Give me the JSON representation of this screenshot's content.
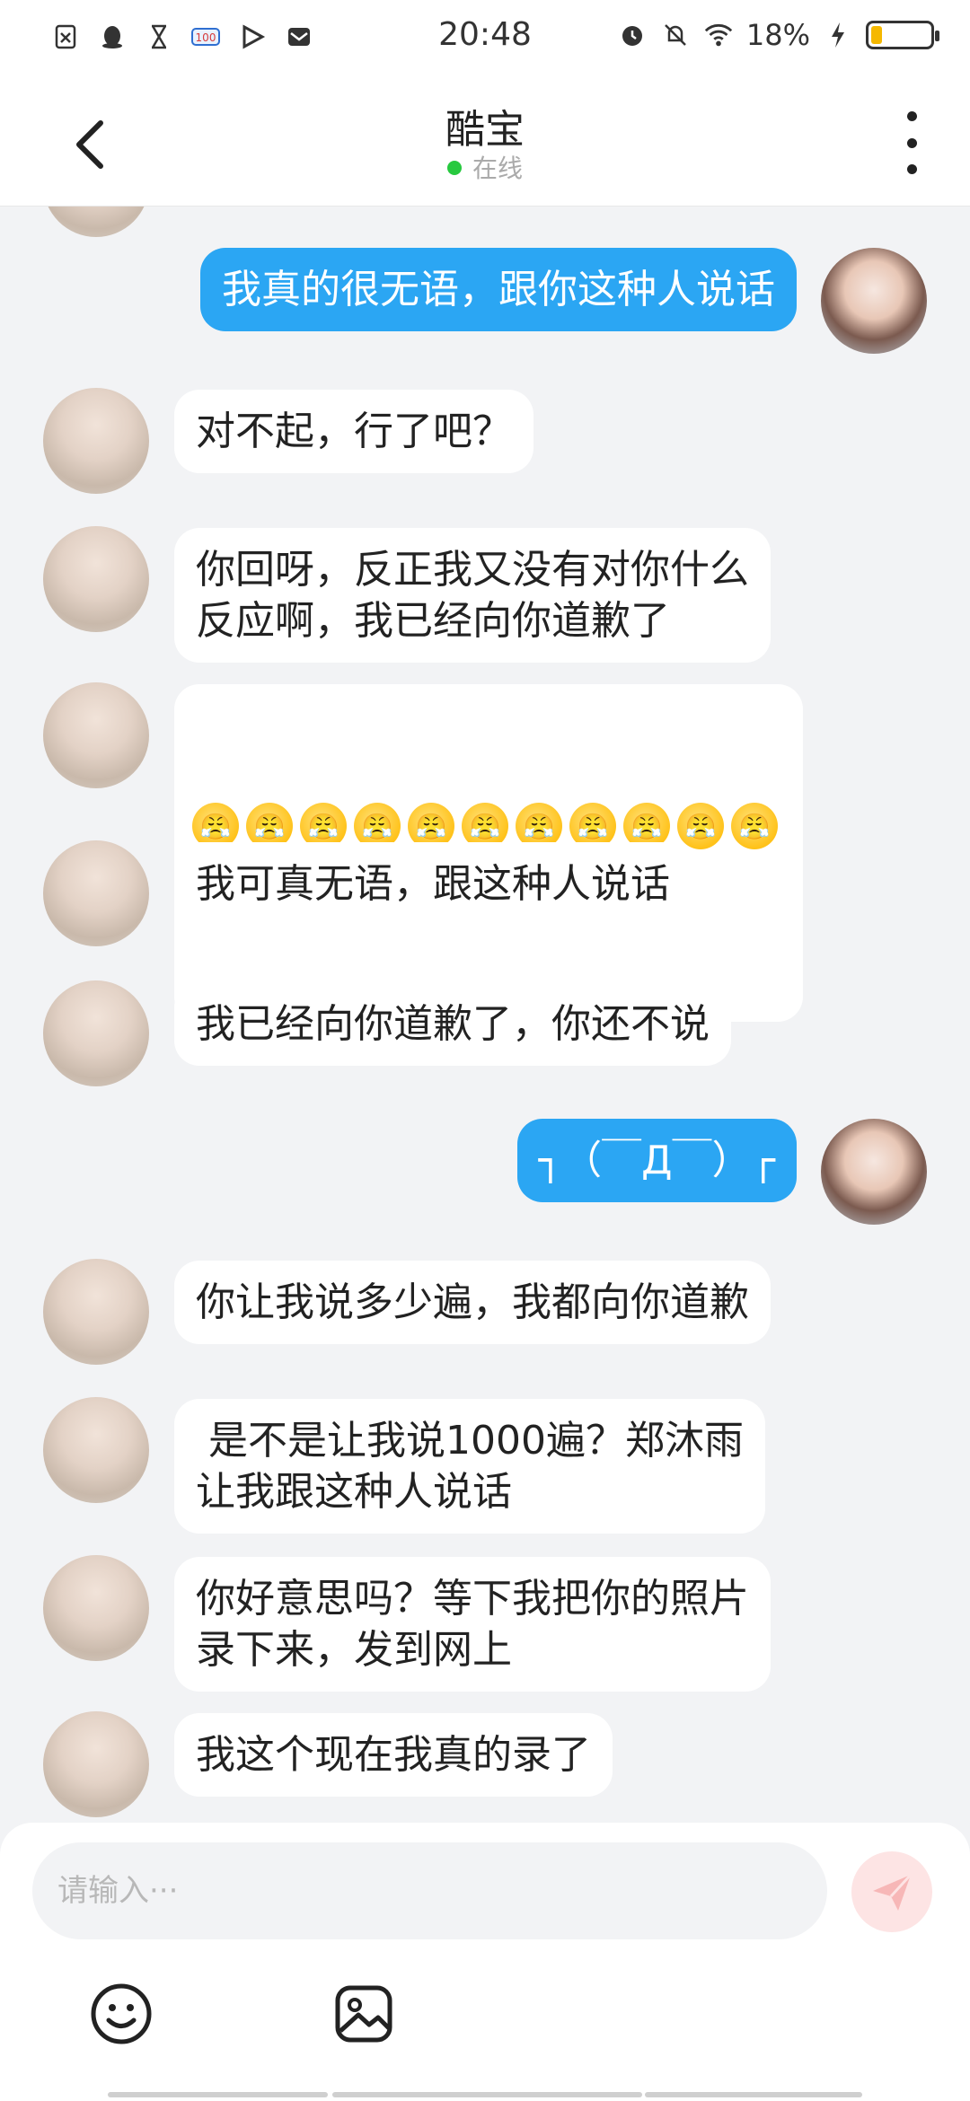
{
  "status_bar": {
    "time": "20:48",
    "battery_percent": "18%",
    "battery_level": 0.18,
    "left_icons": [
      "sim-icon",
      "qq-icon",
      "hourglass-icon",
      "100-icon",
      "play-icon",
      "mail-icon"
    ],
    "right_icons": [
      "alarm-icon",
      "mute-icon",
      "wifi-icon",
      "charging-icon"
    ]
  },
  "header": {
    "title": "酷宝",
    "status": "在线",
    "back_icon": "chevron-left-icon",
    "more_icon": "more-vertical-icon"
  },
  "messages": [
    {
      "from": "me",
      "text": "我真的很无语，跟你这种人说话"
    },
    {
      "from": "other",
      "text": "对不起，行了吧？"
    },
    {
      "from": "other",
      "text": "你回呀，反正我又没有对你什么\n反应啊，我已经向你道歉了"
    },
    {
      "from": "other",
      "emojis": [
        "😤",
        "😤",
        "😤",
        "😤",
        "😤",
        "😤",
        "😤",
        "😤",
        "😤",
        "😤",
        "😤",
        "😡",
        "😡",
        "😡"
      ]
    },
    {
      "from": "other",
      "text": "我可真无语，跟这种人说话"
    },
    {
      "from": "other",
      "text": "我已经向你道歉了，你还不说"
    },
    {
      "from": "me",
      "text": "┐（￣Д￣）┌"
    },
    {
      "from": "other",
      "text": "你让我说多少遍，我都向你道歉"
    },
    {
      "from": "other",
      "text": " 是不是让我说1000遍？郑沐雨\n让我跟这种人说话"
    },
    {
      "from": "other",
      "text": "你好意思吗？等下我把你的照片\n录下来，发到网上"
    },
    {
      "from": "other",
      "text": "我这个现在我真的录了"
    }
  ],
  "composer": {
    "placeholder": "请输入···",
    "send_icon": "send-icon",
    "emoji_icon": "smiley-icon",
    "image_icon": "image-icon"
  },
  "colors": {
    "my_bubble": "#2ba6f3",
    "other_bubble": "#ffffff",
    "background": "#f2f3f5",
    "online": "#27c93f"
  }
}
